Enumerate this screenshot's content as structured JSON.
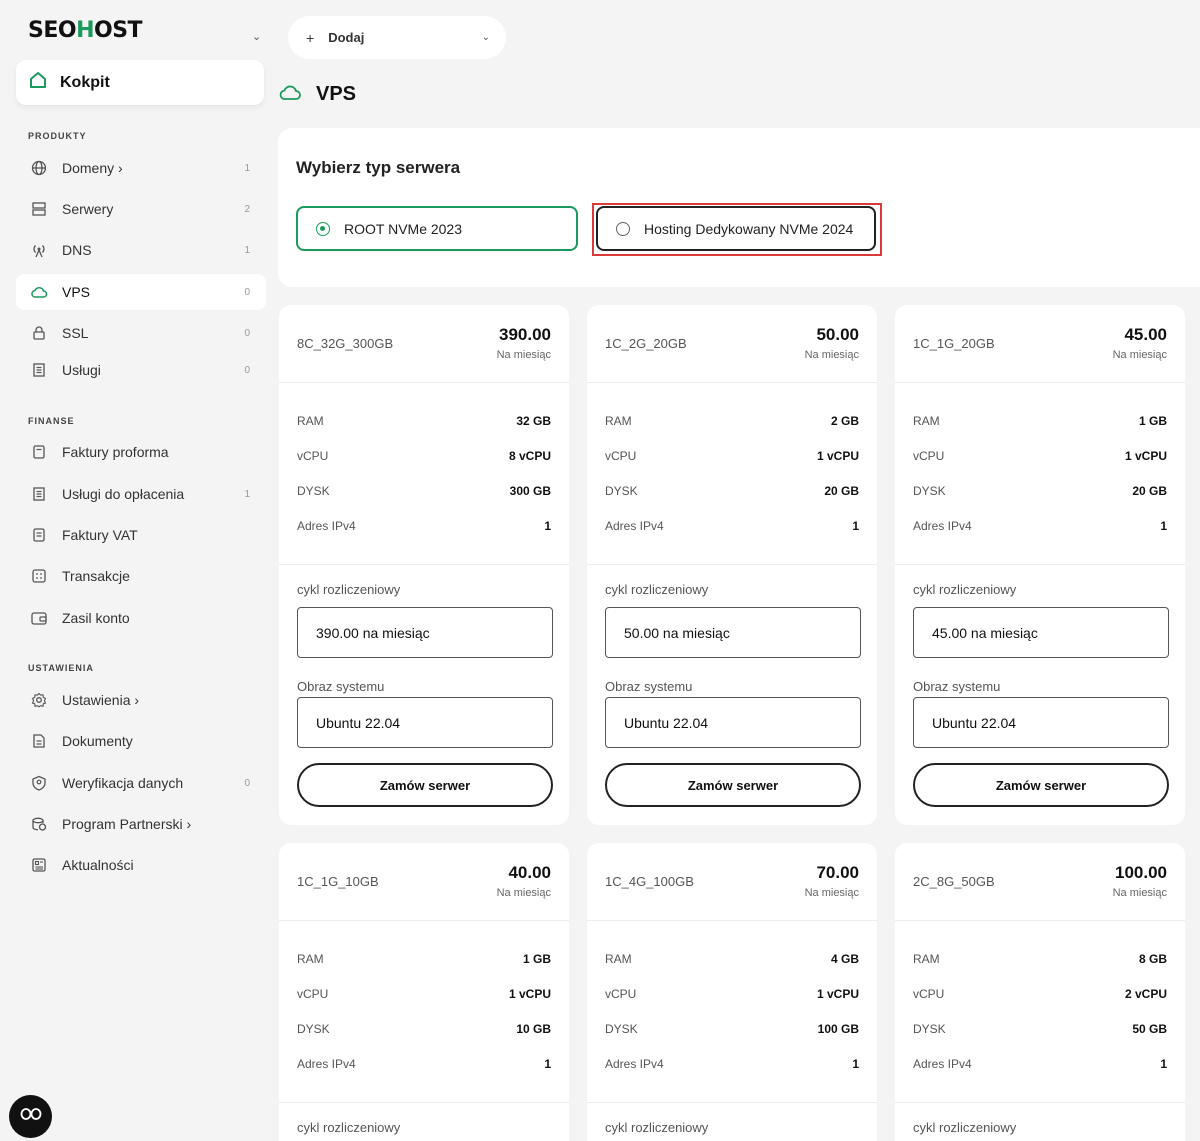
{
  "brand": {
    "logo_pre": "SEO",
    "logo_h": "H",
    "logo_post": "OST"
  },
  "sidebar": {
    "kokpit": "Kokpit",
    "sections": {
      "produkty": "PRODUKTY",
      "finanse": "FINANSE",
      "ustawienia": "USTAWIENIA"
    },
    "items": [
      {
        "label": "Domeny ›",
        "count": "1",
        "icon": "globe-icon"
      },
      {
        "label": "Serwery",
        "count": "2",
        "icon": "server-icon"
      },
      {
        "label": "DNS",
        "count": "1",
        "icon": "antenna-icon"
      },
      {
        "label": "VPS",
        "count": "0",
        "icon": "cloud-icon"
      },
      {
        "label": "SSL",
        "count": "0",
        "icon": "lock-icon"
      },
      {
        "label": "Usługi",
        "count": "0",
        "icon": "list-icon"
      },
      {
        "label": "Faktury proforma",
        "count": "",
        "icon": "document-icon"
      },
      {
        "label": "Usługi do opłacenia",
        "count": "1",
        "icon": "receipt-icon"
      },
      {
        "label": "Faktury VAT",
        "count": "",
        "icon": "invoice-icon"
      },
      {
        "label": "Transakcje",
        "count": "",
        "icon": "grid-icon"
      },
      {
        "label": "Zasil konto",
        "count": "",
        "icon": "wallet-icon"
      },
      {
        "label": "Ustawienia ›",
        "count": "",
        "icon": "gear-icon"
      },
      {
        "label": "Dokumenty",
        "count": "",
        "icon": "file-icon"
      },
      {
        "label": "Weryfikacja danych",
        "count": "0",
        "icon": "shield-icon"
      },
      {
        "label": "Program Partnerski ›",
        "count": "",
        "icon": "coins-icon"
      },
      {
        "label": "Aktualności",
        "count": "",
        "icon": "news-icon"
      }
    ]
  },
  "top": {
    "add_label": "Dodaj",
    "plus": "+",
    "chev": "⌄"
  },
  "page": {
    "title": "VPS"
  },
  "server_type": {
    "title": "Wybierz typ serwera",
    "options": [
      {
        "label": "ROOT NVMe 2023",
        "selected": true
      },
      {
        "label": "Hosting Dedykowany NVMe 2024",
        "selected": false
      }
    ]
  },
  "spec_labels": {
    "ram": "RAM",
    "vcpu": "vCPU",
    "disk": "DYSK",
    "ipv4": "Adres IPv4"
  },
  "labels": {
    "per_month": "Na miesiąc",
    "cycle": "cykl rozliczeniowy",
    "os": "Obraz systemu",
    "order": "Zamów serwer"
  },
  "plans": [
    {
      "name": "8C_32G_300GB",
      "price": "390.00",
      "ram": "32 GB",
      "vcpu": "8 vCPU",
      "disk": "300 GB",
      "ipv4": "1",
      "cycle": "390.00 na miesiąc",
      "os": "Ubuntu 22.04"
    },
    {
      "name": "1C_2G_20GB",
      "price": "50.00",
      "ram": "2 GB",
      "vcpu": "1 vCPU",
      "disk": "20 GB",
      "ipv4": "1",
      "cycle": "50.00 na miesiąc",
      "os": "Ubuntu 22.04"
    },
    {
      "name": "1C_1G_20GB",
      "price": "45.00",
      "ram": "1 GB",
      "vcpu": "1 vCPU",
      "disk": "20 GB",
      "ipv4": "1",
      "cycle": "45.00 na miesiąc",
      "os": "Ubuntu 22.04"
    },
    {
      "name": "1C_1G_10GB",
      "price": "40.00",
      "ram": "1 GB",
      "vcpu": "1 vCPU",
      "disk": "10 GB",
      "ipv4": "1"
    },
    {
      "name": "1C_4G_100GB",
      "price": "70.00",
      "ram": "4 GB",
      "vcpu": "1 vCPU",
      "disk": "100 GB",
      "ipv4": "1"
    },
    {
      "name": "2C_8G_50GB",
      "price": "100.00",
      "ram": "8 GB",
      "vcpu": "2 vCPU",
      "disk": "50 GB",
      "ipv4": "1"
    }
  ],
  "colors": {
    "accent": "#1a9a5c",
    "highlight": "#d93b3b"
  }
}
